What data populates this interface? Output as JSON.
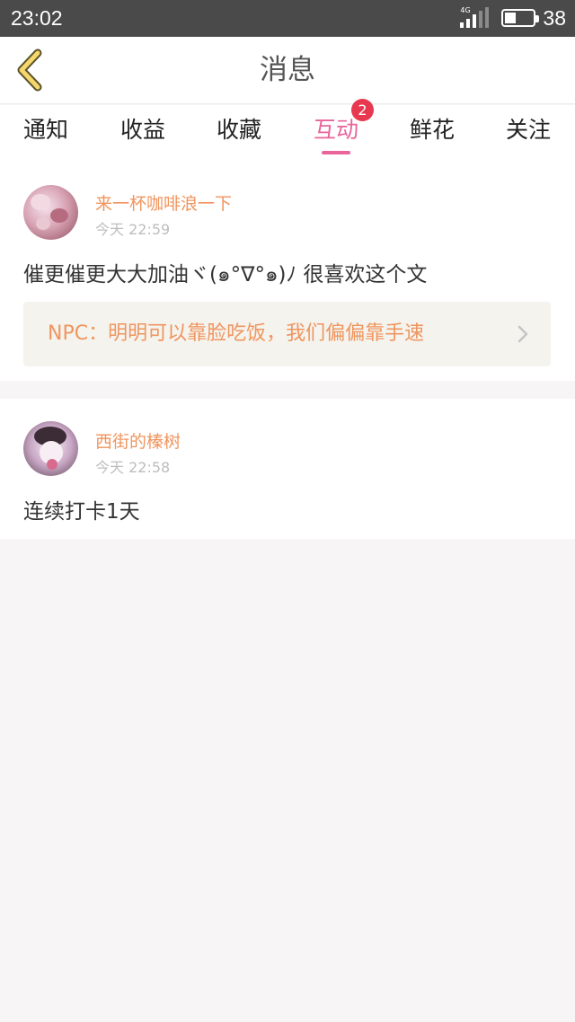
{
  "status_bar": {
    "time": "23:02",
    "network": "4G",
    "battery_level": "38"
  },
  "header": {
    "title": "消息",
    "back_icon": "chevron-left-icon"
  },
  "tabs": [
    {
      "label": "通知",
      "active": false
    },
    {
      "label": "收益",
      "active": false
    },
    {
      "label": "收藏",
      "active": false
    },
    {
      "label": "互动",
      "active": true,
      "badge": "2"
    },
    {
      "label": "鲜花",
      "active": false
    },
    {
      "label": "关注",
      "active": false
    }
  ],
  "messages": [
    {
      "username": "来一杯咖啡浪一下",
      "time": "今天 22:59",
      "content": "催更催更大大加油ヾ(๑°∇°๑)ﾉ 很喜欢这个文",
      "quote": "NPC：明明可以靠脸吃饭，我们偏偏靠手速"
    },
    {
      "username": "西街的榛树",
      "time": "今天 22:58",
      "content": "连续打卡1天"
    }
  ],
  "colors": {
    "accent": "#e8649b",
    "username": "#f0955e",
    "badge": "#e8384f",
    "back_icon": "#f5d76e"
  }
}
